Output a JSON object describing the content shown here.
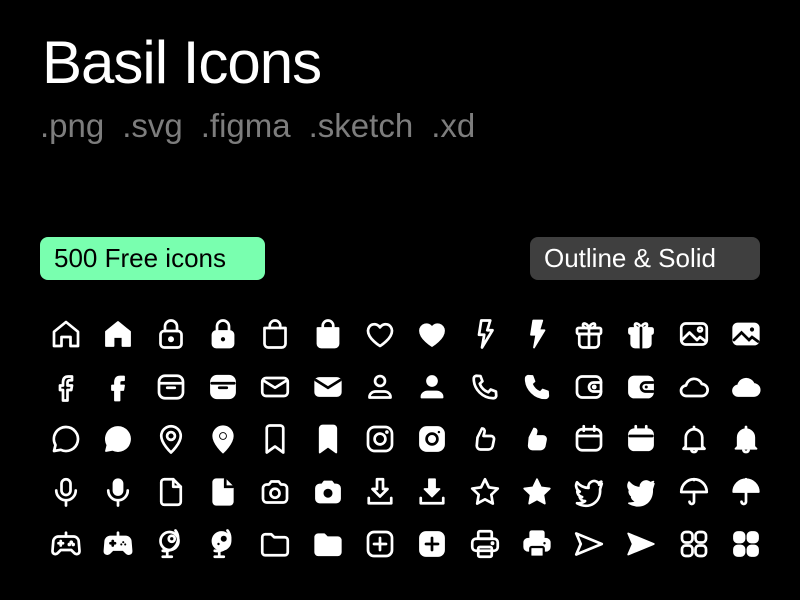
{
  "header": {
    "title": "Basil Icons",
    "formats": [
      ".png",
      ".svg",
      ".figma",
      ".sketch",
      ".xd"
    ]
  },
  "badges": {
    "free": "500 Free icons",
    "styles": "Outline & Solid"
  },
  "colors": {
    "background": "#000000",
    "accent": "#79ffaf",
    "secondary_badge": "#3f3f3f",
    "subtitle": "#7d7d7d"
  },
  "icon_grid": {
    "rows": [
      [
        "home-outline",
        "home-solid",
        "lock-outline",
        "lock-solid",
        "shopping-bag-outline",
        "shopping-bag-solid",
        "heart-outline",
        "heart-solid",
        "lightning-outline",
        "lightning-solid",
        "gift-outline",
        "gift-solid",
        "image-outline",
        "image-solid"
      ],
      [
        "facebook-outline",
        "facebook-solid",
        "archive-outline",
        "archive-solid",
        "envelope-outline",
        "envelope-solid",
        "user-outline",
        "user-solid",
        "phone-outline",
        "phone-solid",
        "wallet-outline",
        "wallet-solid",
        "cloud-outline",
        "cloud-solid"
      ],
      [
        "comment-outline",
        "comment-solid",
        "location-outline",
        "location-solid",
        "bookmark-outline",
        "bookmark-solid",
        "instagram-outline",
        "instagram-solid",
        "like-outline",
        "like-solid",
        "calendar-outline",
        "calendar-solid",
        "notification-outline",
        "notification-solid"
      ],
      [
        "microphone-outline",
        "microphone-solid",
        "document-outline",
        "document-solid",
        "camera-outline",
        "camera-solid",
        "download-outline",
        "download-solid",
        "star-outline",
        "star-solid",
        "twitter-outline",
        "twitter-solid",
        "umbrella-outline",
        "umbrella-solid"
      ],
      [
        "gamepad-outline",
        "gamepad-solid",
        "globe-outline",
        "globe-solid",
        "folder-outline",
        "folder-solid",
        "plus-outline",
        "plus-solid",
        "printer-outline",
        "printer-solid",
        "send-outline",
        "send-solid",
        "apps-outline",
        "apps-solid"
      ]
    ]
  }
}
